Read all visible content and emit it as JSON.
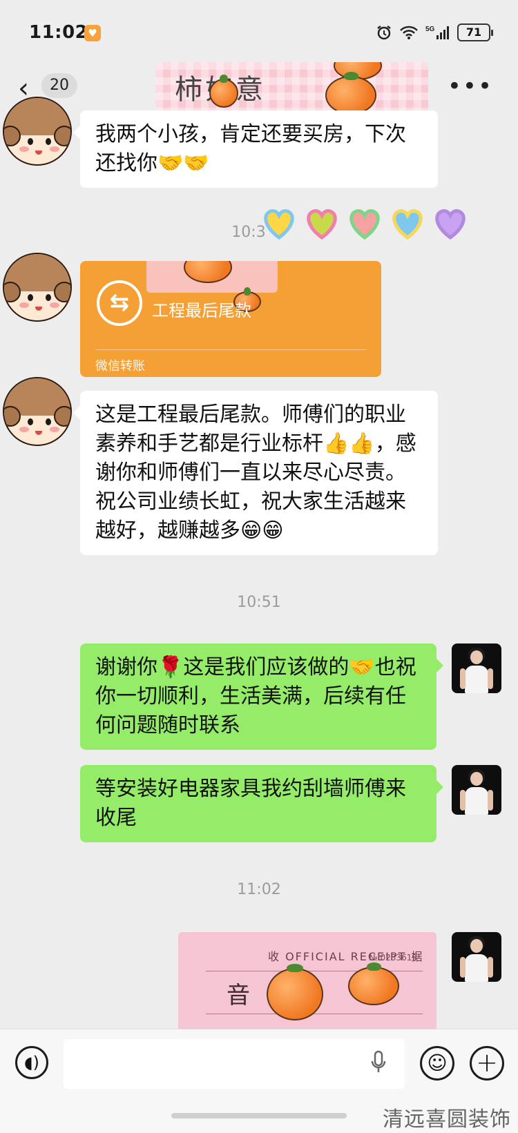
{
  "status_bar": {
    "time": "11:02",
    "network": "5G",
    "battery": "71"
  },
  "header": {
    "back_icon": "chevron-left-icon",
    "unread_count": "20",
    "title_sticker_text": "柿如意",
    "more_icon": "more-dots-icon"
  },
  "messages": [
    {
      "side": "left",
      "type": "text",
      "text": "我两个小孩，肯定还要买房，下次还找你🤝🤝"
    },
    {
      "type": "timestamp",
      "text": "10:3"
    },
    {
      "side": "left",
      "type": "transfer",
      "title": "工程最后尾款",
      "footer": "微信转账"
    },
    {
      "side": "left",
      "type": "text",
      "text": "这是工程最后尾款。师傅们的职业素养和手艺都是行业标杆👍👍，感谢你和师傅们一直以来尽心尽责。祝公司业绩长虹，祝大家生活越来越好，越赚越多😁😁"
    },
    {
      "type": "timestamp",
      "text": "10:51"
    },
    {
      "side": "right",
      "type": "text",
      "text": "谢谢你🌹这是我们应该做的🤝也祝你一切顺利，生活美满，后续有任何问题随时联系"
    },
    {
      "side": "right",
      "type": "text",
      "text": "等安装好电器家具我约刮墙师傅来收尾"
    },
    {
      "type": "timestamp",
      "text": "11:02"
    },
    {
      "side": "right",
      "type": "image",
      "receipt_head": "收 OFFICIAL RECEIPT 据",
      "receipt_no": "№ 0233619",
      "receipt_seal": "音"
    }
  ],
  "input_bar": {
    "voice_icon": "voice-icon",
    "mic_icon": "microphone-icon",
    "emoji_icon": "emoji-icon",
    "plus_icon": "plus-icon"
  },
  "watermark": "清远喜圆装饰",
  "colors": {
    "chat_bg": "#ededed",
    "bubble_green": "#95ec69",
    "bubble_white": "#ffffff",
    "transfer_orange": "#f5a035"
  }
}
